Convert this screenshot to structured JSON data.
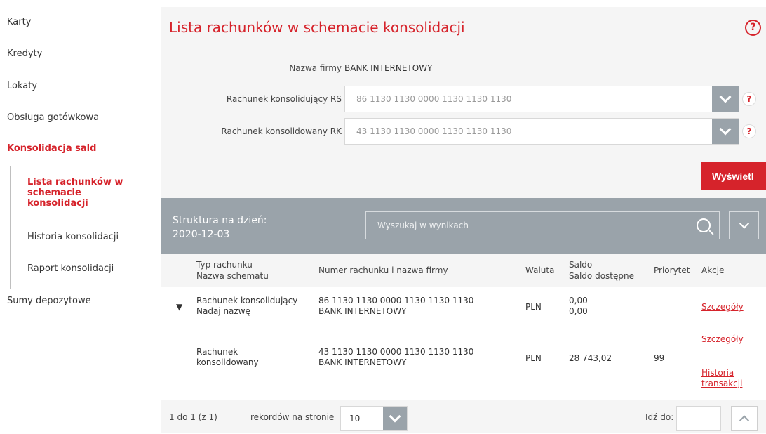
{
  "sidebar": {
    "items": [
      {
        "label": "Karty"
      },
      {
        "label": "Kredyty"
      },
      {
        "label": "Lokaty"
      },
      {
        "label": "Obsługa gotówkowa"
      },
      {
        "label": "Konsolidacja sald"
      },
      {
        "label": "Sumy depozytowe"
      }
    ],
    "sub_items": [
      {
        "label": "Lista rachunków w schemacie konsolidacji"
      },
      {
        "label": "Historia konsolidacji"
      },
      {
        "label": "Raport konsolidacji"
      }
    ]
  },
  "main": {
    "title": "Lista rachunków w schemacie konsolidacji",
    "help_icon": "?",
    "form": {
      "company_label": "Nazwa firmy",
      "company_value": "BANK INTERNETOWY",
      "rs_label": "Rachunek konsolidujący RS",
      "rs_value": "86 1130 1130 0000 1130 1130 1130",
      "rk_label": "Rachunek konsolidowany RK",
      "rk_value": "43 1130 1130 0000 1130 1130 1130",
      "show_button": "Wyświetl"
    },
    "results": {
      "structure_label": "Struktura na dzień:",
      "structure_date": "2020-12-03",
      "search_placeholder": "Wyszukaj w wynikach"
    },
    "table": {
      "headers": {
        "type_line1": "Typ rachunku",
        "type_line2": "Nazwa schematu",
        "account": "Numer rachunku i nazwa firmy",
        "currency": "Waluta",
        "balance_line1": "Saldo",
        "balance_line2": "Saldo dostępne",
        "priority": "Priorytet",
        "actions": "Akcje"
      },
      "rows": [
        {
          "expander": "▼",
          "type": "Rachunek konsolidujący",
          "scheme_name": "Nadaj nazwę",
          "account_number": "86 1130 1130  0000 1130 1130 1130",
          "company": "BANK INTERNETOWY",
          "currency": "PLN",
          "balance": "0,00",
          "available": "0,00",
          "priority": "",
          "action1": "Szczegóły"
        },
        {
          "type_line1": "Rachunek",
          "type_line2": "konsolidowany",
          "account_number": "43 1130 1130  0000 1130 1130 1130",
          "company": "BANK INTERNETOWY",
          "currency": "PLN",
          "balance": "28 743,02",
          "priority": "99",
          "action1": "Szczegóły",
          "action2_line1": "Historia",
          "action2_line2": "transakcji"
        }
      ]
    },
    "footer": {
      "range": "1 do 1 (z 1)",
      "per_page_label": "rekordów na stronie",
      "per_page_value": "10",
      "goto_label": "Idź do:",
      "goto_value": ""
    }
  }
}
